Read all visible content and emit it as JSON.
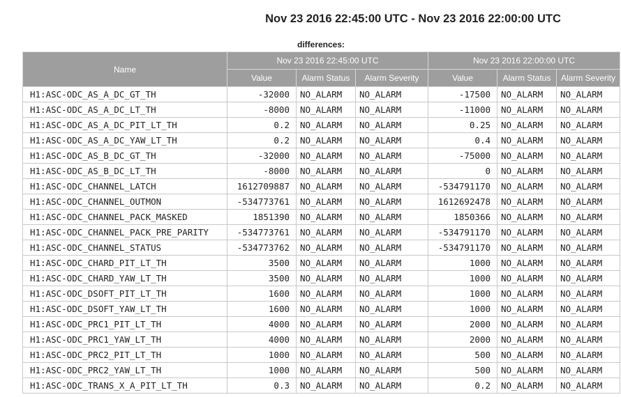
{
  "title": "Nov 23 2016 22:45:00 UTC - Nov 23 2016 22:00:00 UTC",
  "caption": "differences:",
  "header": {
    "name": "Name",
    "groups": [
      "Nov 23 2016 22:45:00 UTC",
      "Nov 23 2016 22:00:00 UTC"
    ],
    "columns": [
      "Value",
      "Alarm Status",
      "Alarm Severity"
    ]
  },
  "rows": [
    [
      "H1:ASC-ODC_AS_A_DC_GT_TH",
      "-32000",
      "NO_ALARM",
      "NO_ALARM",
      "-17500",
      "NO_ALARM",
      "NO_ALARM"
    ],
    [
      "H1:ASC-ODC_AS_A_DC_LT_TH",
      "-8000",
      "NO_ALARM",
      "NO_ALARM",
      "-11000",
      "NO_ALARM",
      "NO_ALARM"
    ],
    [
      "H1:ASC-ODC_AS_A_DC_PIT_LT_TH",
      "0.2",
      "NO_ALARM",
      "NO_ALARM",
      "0.25",
      "NO_ALARM",
      "NO_ALARM"
    ],
    [
      "H1:ASC-ODC_AS_A_DC_YAW_LT_TH",
      "0.2",
      "NO_ALARM",
      "NO_ALARM",
      "0.4",
      "NO_ALARM",
      "NO_ALARM"
    ],
    [
      "H1:ASC-ODC_AS_B_DC_GT_TH",
      "-32000",
      "NO_ALARM",
      "NO_ALARM",
      "-75000",
      "NO_ALARM",
      "NO_ALARM"
    ],
    [
      "H1:ASC-ODC_AS_B_DC_LT_TH",
      "-8000",
      "NO_ALARM",
      "NO_ALARM",
      "0",
      "NO_ALARM",
      "NO_ALARM"
    ],
    [
      "H1:ASC-ODC_CHANNEL_LATCH",
      "1612709887",
      "NO_ALARM",
      "NO_ALARM",
      "-534791170",
      "NO_ALARM",
      "NO_ALARM"
    ],
    [
      "H1:ASC-ODC_CHANNEL_OUTMON",
      "-534773761",
      "NO_ALARM",
      "NO_ALARM",
      "1612692478",
      "NO_ALARM",
      "NO_ALARM"
    ],
    [
      "H1:ASC-ODC_CHANNEL_PACK_MASKED",
      "1851390",
      "NO_ALARM",
      "NO_ALARM",
      "1850366",
      "NO_ALARM",
      "NO_ALARM"
    ],
    [
      "H1:ASC-ODC_CHANNEL_PACK_PRE_PARITY",
      "-534773761",
      "NO_ALARM",
      "NO_ALARM",
      "-534791170",
      "NO_ALARM",
      "NO_ALARM"
    ],
    [
      "H1:ASC-ODC_CHANNEL_STATUS",
      "-534773762",
      "NO_ALARM",
      "NO_ALARM",
      "-534791170",
      "NO_ALARM",
      "NO_ALARM"
    ],
    [
      "H1:ASC-ODC_CHARD_PIT_LT_TH",
      "3500",
      "NO_ALARM",
      "NO_ALARM",
      "1000",
      "NO_ALARM",
      "NO_ALARM"
    ],
    [
      "H1:ASC-ODC_CHARD_YAW_LT_TH",
      "3500",
      "NO_ALARM",
      "NO_ALARM",
      "1000",
      "NO_ALARM",
      "NO_ALARM"
    ],
    [
      "H1:ASC-ODC_DSOFT_PIT_LT_TH",
      "1600",
      "NO_ALARM",
      "NO_ALARM",
      "1000",
      "NO_ALARM",
      "NO_ALARM"
    ],
    [
      "H1:ASC-ODC_DSOFT_YAW_LT_TH",
      "1600",
      "NO_ALARM",
      "NO_ALARM",
      "1000",
      "NO_ALARM",
      "NO_ALARM"
    ],
    [
      "H1:ASC-ODC_PRC1_PIT_LT_TH",
      "4000",
      "NO_ALARM",
      "NO_ALARM",
      "2000",
      "NO_ALARM",
      "NO_ALARM"
    ],
    [
      "H1:ASC-ODC_PRC1_YAW_LT_TH",
      "4000",
      "NO_ALARM",
      "NO_ALARM",
      "2000",
      "NO_ALARM",
      "NO_ALARM"
    ],
    [
      "H1:ASC-ODC_PRC2_PIT_LT_TH",
      "1000",
      "NO_ALARM",
      "NO_ALARM",
      "500",
      "NO_ALARM",
      "NO_ALARM"
    ],
    [
      "H1:ASC-ODC_PRC2_YAW_LT_TH",
      "1000",
      "NO_ALARM",
      "NO_ALARM",
      "500",
      "NO_ALARM",
      "NO_ALARM"
    ],
    [
      "H1:ASC-ODC_TRANS_X_A_PIT_LT_TH",
      "0.3",
      "NO_ALARM",
      "NO_ALARM",
      "0.2",
      "NO_ALARM",
      "NO_ALARM"
    ]
  ]
}
